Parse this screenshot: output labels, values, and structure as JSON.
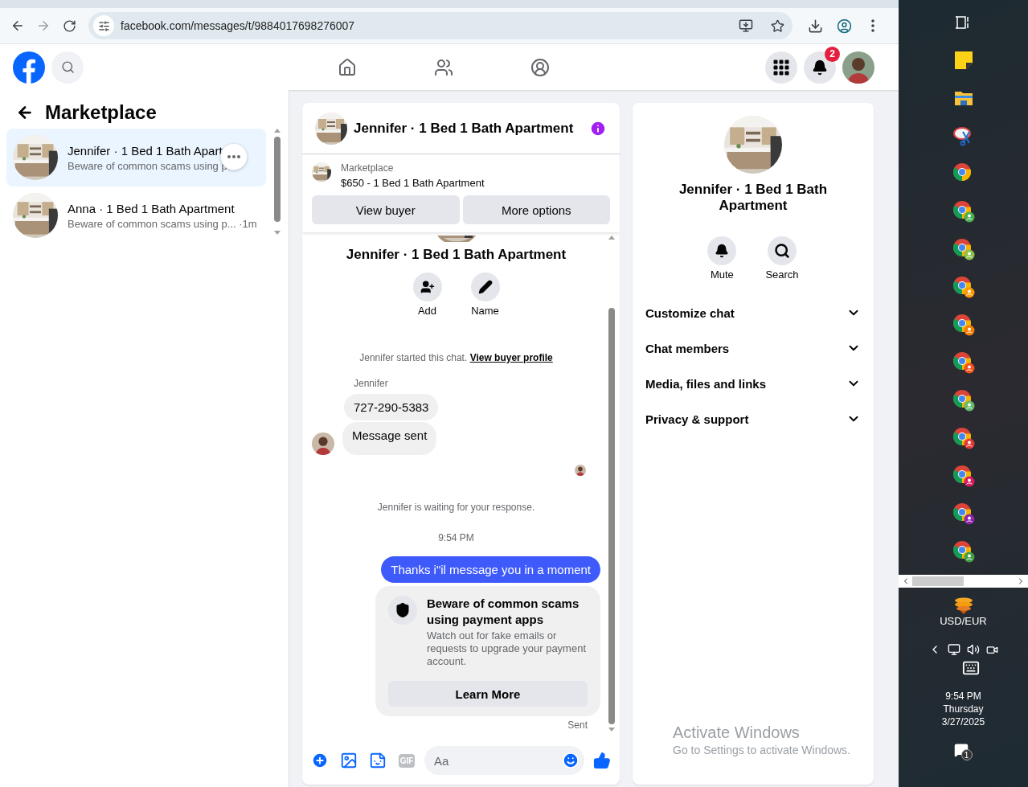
{
  "browser": {
    "url": "facebook.com/messages/t/9884017698276007",
    "forward_disabled": true
  },
  "header": {
    "notification_count": "2"
  },
  "sidebar": {
    "title": "Marketplace",
    "conversations": [
      {
        "title": "Jennifer · 1 Bed 1 Bath Apart",
        "snippet": "Beware of common scams using p",
        "selected": true
      },
      {
        "title": "Anna · 1 Bed 1 Bath Apartment",
        "snippet": "Beware of common scams using p...",
        "time": "·1m",
        "selected": false
      }
    ]
  },
  "chat": {
    "title": "Jennifer · 1 Bed 1 Bath Apartment",
    "listing": {
      "label": "Marketplace",
      "text": "$650 - 1 Bed 1 Bath Apartment"
    },
    "actions": [
      "View buyer",
      "More options"
    ],
    "intro_title": "Jennifer · 1 Bed 1 Bath Apartment",
    "intro_actions": [
      {
        "kind": "add",
        "label": "Add"
      },
      {
        "kind": "name",
        "label": "Name"
      }
    ],
    "messages": [
      {
        "kind": "system",
        "text": "Jennifer started this chat.",
        "link": "View buyer profile"
      },
      {
        "kind": "sender",
        "text": "Jennifer"
      },
      {
        "kind": "incoming",
        "text": "727-290-5383",
        "avatar": false
      },
      {
        "kind": "incoming",
        "text": "Message sent",
        "avatar": true
      },
      {
        "kind": "seen"
      },
      {
        "kind": "system",
        "text": "Jennifer is waiting for your response."
      },
      {
        "kind": "time",
        "text": "9:54 PM"
      },
      {
        "kind": "outgoing",
        "text": "Thanks i\"il message you in a moment"
      },
      {
        "kind": "notice",
        "title": "Beware of common scams using payment apps",
        "body": "Watch out for fake emails or requests to upgrade your payment account.",
        "button": "Learn More"
      },
      {
        "kind": "status",
        "text": "Sent"
      }
    ],
    "composer": {
      "placeholder": "Aa",
      "gif_label": "GIF"
    }
  },
  "info_panel": {
    "title": "Jennifer · 1 Bed 1 Bath Apartment",
    "actions": [
      {
        "kind": "mute",
        "label": "Mute"
      },
      {
        "kind": "search",
        "label": "Search"
      }
    ],
    "sections": [
      {
        "label": "Customize chat",
        "expanded": false
      },
      {
        "label": "Chat members",
        "expanded": false
      },
      {
        "label": "Media, files and links",
        "expanded": false
      },
      {
        "label": "Privacy & support",
        "expanded": false
      }
    ]
  },
  "taskbar": {
    "apps": [
      {
        "kind": "widgets"
      },
      {
        "kind": "notes"
      },
      {
        "kind": "files"
      },
      {
        "kind": "snip"
      },
      {
        "kind": "chrome"
      },
      {
        "kind": "chrome_profile",
        "color": "#4caf50"
      },
      {
        "kind": "chrome_profile",
        "color": "#8bc34a"
      },
      {
        "kind": "chrome_profile",
        "color": "#ff9800"
      },
      {
        "kind": "chrome_profile",
        "color": "#f57c00"
      },
      {
        "kind": "chrome_profile",
        "color": "#f4511e"
      },
      {
        "kind": "chrome_profile",
        "color": "#66bb6a"
      },
      {
        "kind": "chrome_profile",
        "color": "#e53935"
      },
      {
        "kind": "chrome_profile",
        "color": "#d81b60"
      },
      {
        "kind": "chrome_profile",
        "color": "#8e24aa"
      },
      {
        "kind": "chrome_profile",
        "color": "#43a047"
      }
    ],
    "currency": "USD/EUR",
    "time": "9:54 PM",
    "day": "Thursday",
    "date": "3/27/2025",
    "notifications": "1"
  },
  "activation_notice": {
    "title": "Activate Windows",
    "text": "Go to Settings to activate Windows."
  }
}
